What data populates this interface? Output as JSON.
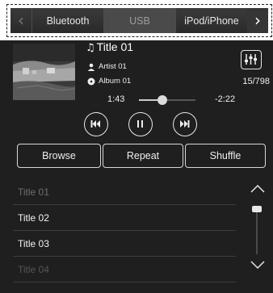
{
  "source_tabs": [
    {
      "label": "Bluetooth",
      "active": false
    },
    {
      "label": "USB",
      "active": true
    },
    {
      "label": "iPod/iPhone",
      "active": false
    }
  ],
  "now_playing": {
    "title": "Title 01",
    "artist": "Artist 01",
    "album": "Album 01",
    "track_counter": "15/798",
    "elapsed": "1:43",
    "remaining": "-2:22",
    "progress_fraction": 0.42
  },
  "modes": {
    "browse": "Browse",
    "repeat": "Repeat",
    "shuffle": "Shuffle"
  },
  "track_list": [
    {
      "title": "Title 01",
      "state": "dim"
    },
    {
      "title": "Title 02",
      "state": "normal"
    },
    {
      "title": "Title 03",
      "state": "normal"
    },
    {
      "title": "Title 04",
      "state": "faded"
    }
  ],
  "scroll_position_fraction": 0.0,
  "colors": {
    "background": "#1f1f1f",
    "source_strip": "#333333",
    "active_tab": "#4a4a4a",
    "text": "#f2f2f2",
    "dim_text": "#6e6e6e"
  },
  "icons": {
    "prev_source": "chevron-left-icon",
    "next_source": "chevron-right-icon",
    "music_note": "music-note-icon",
    "artist": "person-icon",
    "album": "disc-icon",
    "equalizer": "equalizer-icon",
    "previous": "skip-previous-icon",
    "pause": "pause-icon",
    "next": "skip-next-icon",
    "scroll_up": "chevron-up-icon",
    "scroll_down": "chevron-down-icon"
  }
}
